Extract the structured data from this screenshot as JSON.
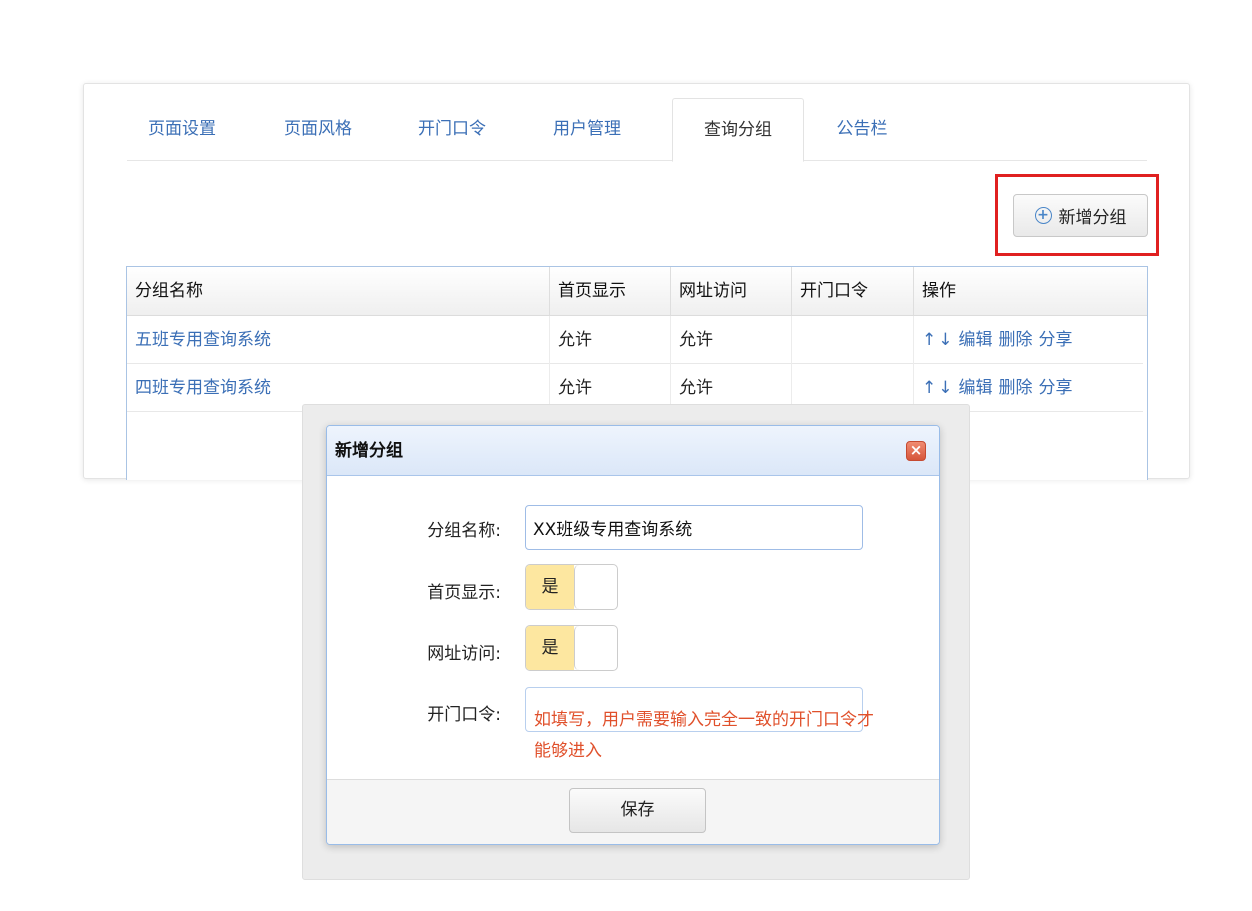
{
  "tabs": [
    {
      "label": "页面设置"
    },
    {
      "label": "页面风格"
    },
    {
      "label": "开门口令"
    },
    {
      "label": "用户管理"
    },
    {
      "label": "查询分组"
    },
    {
      "label": "公告栏"
    }
  ],
  "toolbar": {
    "add_group_label": "新增分组"
  },
  "table": {
    "columns": [
      "分组名称",
      "首页显示",
      "网址访问",
      "开门口令",
      "操作"
    ],
    "rows": [
      {
        "name": "五班专用查询系统",
        "home_display": "允许",
        "url_access": "允许",
        "door_password": "",
        "ops": [
          "↑",
          "↓",
          "编辑",
          "删除",
          "分享"
        ]
      },
      {
        "name": "四班专用查询系统",
        "home_display": "允许",
        "url_access": "允许",
        "door_password": "",
        "ops": [
          "↑",
          "↓",
          "编辑",
          "删除",
          "分享"
        ]
      }
    ]
  },
  "dialog": {
    "title": "新增分组",
    "close_glyph": "×",
    "fields": {
      "group_name_label": "分组名称:",
      "group_name_value": "XX班级专用查询系统",
      "home_display_label": "首页显示:",
      "home_display_value": "是",
      "url_access_label": "网址访问:",
      "url_access_value": "是",
      "door_password_label": "开门口令:",
      "door_password_hint": "如填写，用户需要输入完全一致的开门口令才能够进入"
    },
    "save_label": "保存"
  },
  "colors": {
    "link": "#3b6fb6",
    "highlight": "#e02020",
    "hint": "#e0502b",
    "switch_on": "#fde7a0"
  }
}
